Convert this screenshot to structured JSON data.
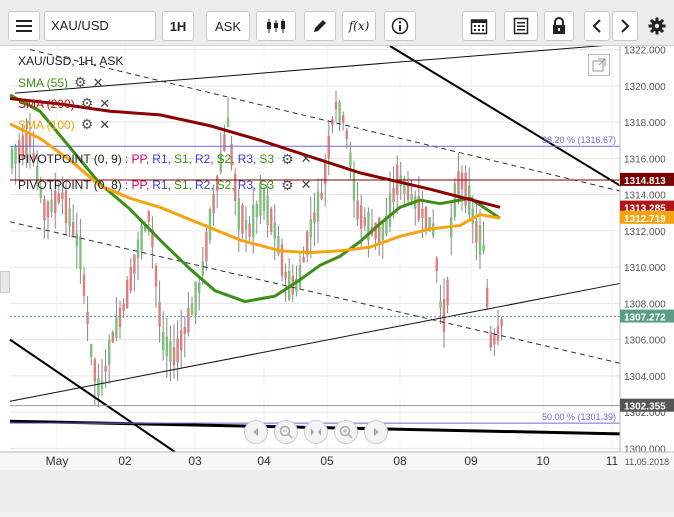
{
  "toolbar": {
    "menu_icon": "hamburger-menu-icon",
    "symbol_value": "XAU/USD",
    "timeframe_label": "1H",
    "price_type_label": "ASK",
    "tools": [
      "candlestick-chart-icon",
      "pen-drawing-icon",
      "function-fx-icon",
      "info-icon",
      "calendar-icon",
      "document-icon",
      "lock-icon",
      "arrow-left-icon",
      "arrow-right-icon",
      "settings-gear-icon"
    ],
    "fx_label": "f(x)"
  },
  "chart_header": {
    "title": "XAU/USD, 1H, ASK",
    "indicators": [
      {
        "label": "SMA (55)",
        "color": "#3f8f17"
      },
      {
        "label": "SMA (200)",
        "color": "#b01818"
      },
      {
        "label": "SMA (100)",
        "color": "#f5a30f"
      }
    ],
    "pivot_rows": [
      {
        "label": "PIVOTPOINT (0, 9)",
        "levels": [
          ": PP,",
          "R1,",
          "S1,",
          "R2,",
          "S2,",
          "R3,",
          "S3"
        ]
      },
      {
        "label": "PIVOTPOINT (0, 8)",
        "levels": [
          ": PP,",
          "R1,",
          "S1,",
          "R2,",
          "S2,",
          "R3,",
          "S3"
        ]
      }
    ],
    "pivot_level_colors": [
      "#d6007a",
      "#4040d0",
      "#3f8f17",
      "#4040d0",
      "#3f8f17",
      "#4040d0",
      "#3f8f17"
    ]
  },
  "chart_data": {
    "type": "candlestick",
    "symbol": "XAU/USD",
    "timeframe": "1H",
    "price_type": "ASK",
    "x_tick_labels": [
      "May",
      "02",
      "03",
      "04",
      "05",
      "08",
      "09",
      "10",
      "11"
    ],
    "y_ticks": [
      1300.0,
      1302.0,
      1304.0,
      1306.0,
      1308.0,
      1310.0,
      1312.0,
      1314.0,
      1316.0,
      1318.0,
      1320.0,
      1322.0
    ],
    "ylim": [
      1299.8,
      1322.2
    ],
    "price_labels": [
      {
        "value": "1314.813",
        "color": "#7a0000"
      },
      {
        "value": "1313.285",
        "color": "#b01818"
      },
      {
        "value": "1312.719",
        "color": "#f5a30f"
      },
      {
        "value": "1307.272",
        "color": "#5a9e8a"
      },
      {
        "value": "1302.355",
        "color": "#555555"
      }
    ],
    "fib_labels": [
      "38.20 % (1316.67)",
      "50.00 % (1301.39)"
    ],
    "date_label": "11.05.2018",
    "series": [
      {
        "name": "SMA (55)",
        "values": [
          1319.5,
          1318.6,
          1316.6,
          1314.6,
          1313.2,
          1311.5,
          1309.9,
          1308.7,
          1308.1,
          1308.4,
          1309.3,
          1310.1,
          1310.6,
          1311.4,
          1312.4,
          1313.3,
          1313.7,
          1313.5,
          1313.8,
          1312.7
        ],
        "color": "#3f8f17"
      },
      {
        "name": "SMA (200)",
        "values": [
          1319.3,
          1319.0,
          1318.6,
          1318.4,
          1317.8,
          1317.0,
          1316.1,
          1315.2,
          1314.3,
          1313.3
        ]
      },
      {
        "name": "SMA (100)",
        "values": [
          1317.9,
          1317.1,
          1315.9,
          1314.5,
          1313.8,
          1313.3,
          1312.4,
          1311.5,
          1310.9,
          1310.8,
          1310.9,
          1311.1,
          1311.7,
          1312.1,
          1312.3,
          1312.9,
          1312.7
        ]
      }
    ],
    "grid": true,
    "legend": "top-left"
  }
}
